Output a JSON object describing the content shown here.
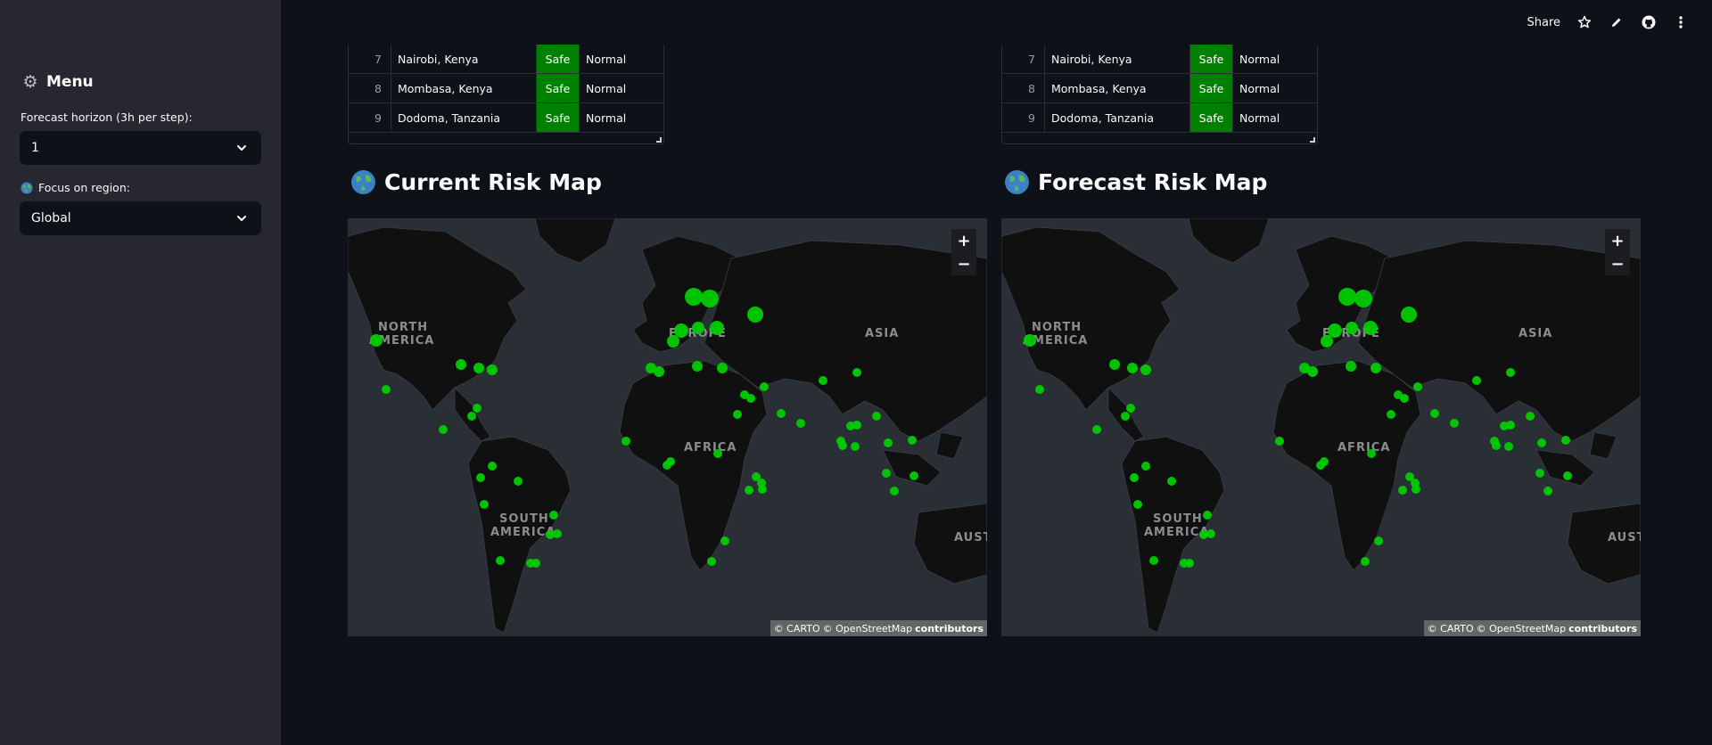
{
  "sidebar": {
    "title": "Menu",
    "horizon_label": "Forecast horizon (3h per step):",
    "horizon_value": "1",
    "region_label": "Focus on region:",
    "region_value": "Global"
  },
  "toolbar": {
    "share_label": "Share"
  },
  "table": {
    "rows": [
      {
        "index": "7",
        "city": "Nairobi, Kenya",
        "status": "Safe",
        "level": "Normal"
      },
      {
        "index": "8",
        "city": "Mombasa, Kenya",
        "status": "Safe",
        "level": "Normal"
      },
      {
        "index": "9",
        "city": "Dodoma, Tanzania",
        "status": "Safe",
        "level": "Normal"
      }
    ]
  },
  "maps": {
    "current": {
      "title": "Current Risk Map",
      "zoom_in": "+",
      "zoom_out": "−",
      "labels": {
        "north_america": [
          "NORTH",
          "AMERICA"
        ],
        "south_america": [
          "SOUTH",
          "AMERICA"
        ],
        "europe": "EUROPE",
        "asia": "ASIA",
        "africa": "AFRICA",
        "australia": "AUST"
      },
      "attribution": {
        "carto": "© CARTO",
        "osm": "© OpenStreetMap",
        "contrib": "contributors"
      }
    },
    "forecast": {
      "title": "Forecast Risk Map",
      "zoom_in": "+",
      "zoom_out": "−",
      "labels": {
        "north_america": [
          "NORTH",
          "AMERICA"
        ],
        "south_america": [
          "SOUTH",
          "AMERICA"
        ],
        "europe": "EUROPE",
        "asia": "ASIA",
        "africa": "AFRICA",
        "australia": "AUST"
      },
      "attribution": {
        "carto": "© CARTO",
        "osm": "© OpenStreetMap",
        "contrib": "contributors"
      }
    }
  },
  "colors": {
    "marker": "#00cc00",
    "safe_cell": "#008000",
    "land": "#101010",
    "water": "#2a2e35"
  }
}
